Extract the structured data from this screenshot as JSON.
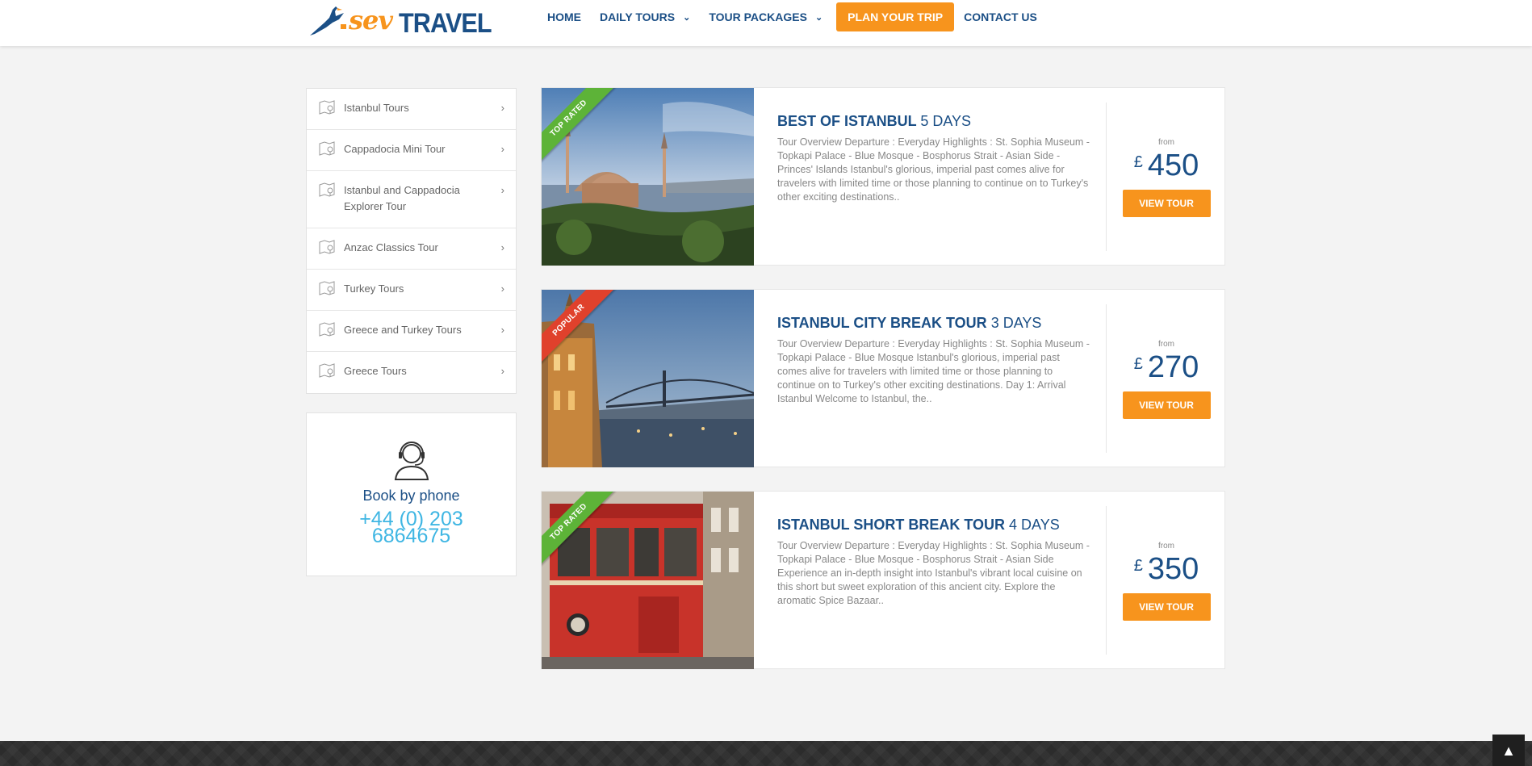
{
  "brand": {
    "logo_sev": "sev",
    "logo_travel": "TRAVEL",
    "accent": "#f7941d",
    "primary": "#1b4f86",
    "phone_color": "#3fb6e3"
  },
  "nav": {
    "items": [
      {
        "label": "HOME",
        "caret": false
      },
      {
        "label": "DAILY TOURS",
        "caret": true
      },
      {
        "label": "TOUR PACKAGES",
        "caret": true
      }
    ],
    "cta": "PLAN YOUR TRIP",
    "contact": "CONTACT US"
  },
  "sidebar": {
    "items": [
      {
        "label": "Istanbul Tours",
        "icon": "map-pin-icon"
      },
      {
        "label": "Cappadocia Mini Tour",
        "icon": "map-pin-icon"
      },
      {
        "label": "Istanbul and Cappadocia Explorer Tour",
        "icon": "map-pin-icon"
      },
      {
        "label": "Anzac Classics Tour",
        "icon": "map-pin-icon"
      },
      {
        "label": "Turkey Tours",
        "icon": "map-pin-icon"
      },
      {
        "label": "Greece and Turkey Tours",
        "icon": "map-pin-icon"
      },
      {
        "label": "Greece Tours",
        "icon": "map-pin-icon"
      }
    ]
  },
  "phone": {
    "heading": "Book by phone",
    "number": "+44 (0) 203 6864675",
    "icon": "headset-agent-icon"
  },
  "tours": [
    {
      "badge": "TOP RATED",
      "badge_color": "#5db338",
      "name": "BEST OF ISTANBUL",
      "days": "5 DAYS",
      "desc": "Tour Overview Departure : Everyday Highlights : St. Sophia Museum - Topkapi Palace - Blue Mosque - Bosphorus Strait - Asian Side - Princes' Islands Istanbul's glorious, imperial past comes alive for travelers with limited time or those planning to continue on to Turkey's other exciting destinations..",
      "from": "from",
      "currency": "£",
      "price": "450",
      "button": "VIEW TOUR"
    },
    {
      "badge": "POPULAR",
      "badge_color": "#e0412c",
      "name": "ISTANBUL CITY BREAK TOUR",
      "days": "3 DAYS",
      "desc": "Tour Overview Departure : Everyday Highlights : St. Sophia Museum - Topkapi Palace - Blue Mosque Istanbul's glorious, imperial past comes alive for travelers with limited time or those planning to continue on to Turkey's other exciting destinations. Day 1: Arrival Istanbul Welcome to Istanbul, the..",
      "from": "from",
      "currency": "£",
      "price": "270",
      "button": "VIEW TOUR"
    },
    {
      "badge": "TOP RATED",
      "badge_color": "#5db338",
      "name": "ISTANBUL SHORT BREAK TOUR",
      "days": "4 DAYS",
      "desc": "Tour Overview Departure : Everyday Highlights : St. Sophia Museum - Topkapi Palace - Blue Mosque - Bosphorus Strait - Asian Side Experience an in-depth insight into Istanbul's vibrant local cuisine on this short but sweet exploration of this ancient city. Explore the aromatic Spice Bazaar..",
      "from": "from",
      "currency": "£",
      "price": "350",
      "button": "VIEW TOUR"
    }
  ],
  "scroll_top": {
    "icon": "chevron-up-icon"
  }
}
